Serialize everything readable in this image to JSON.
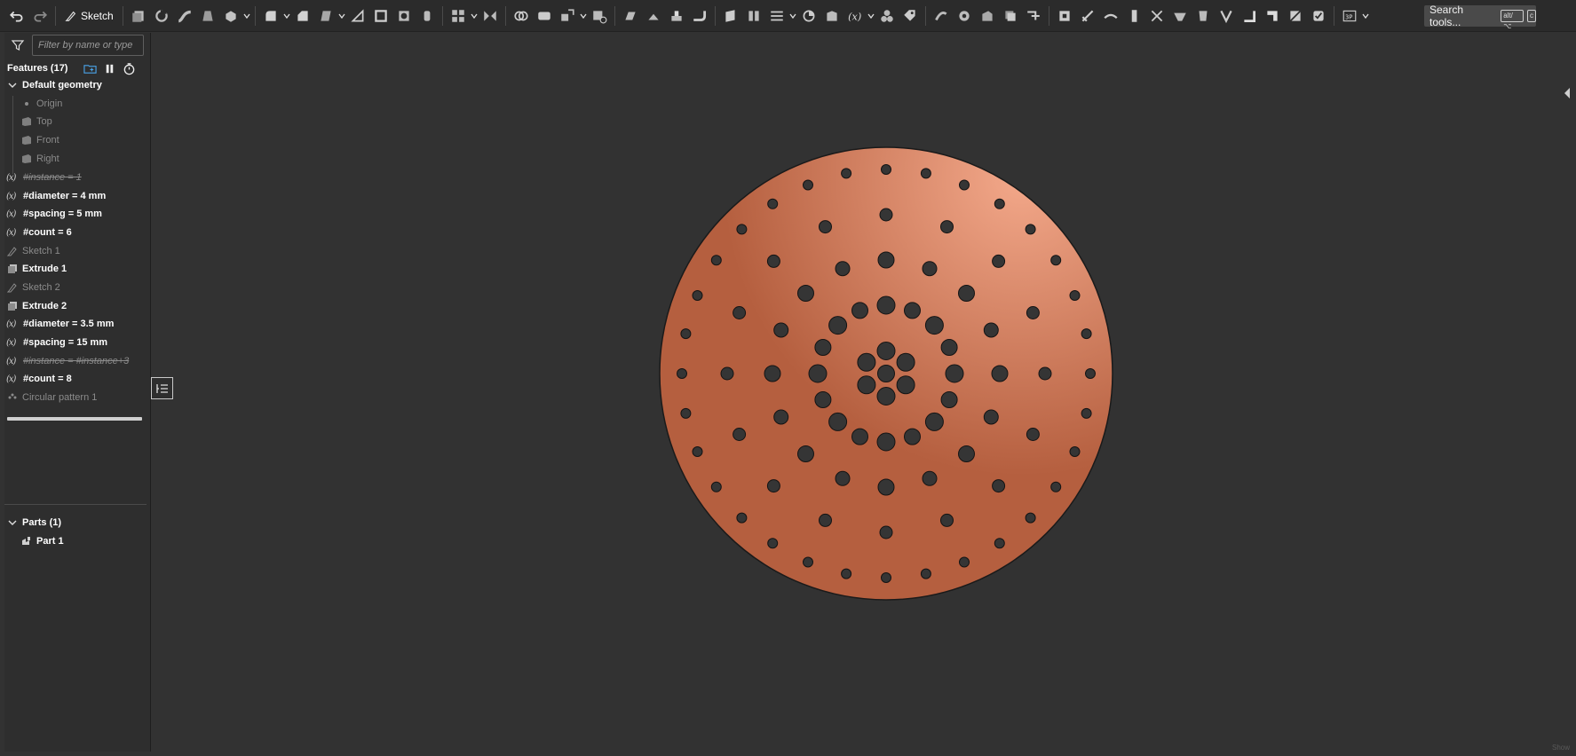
{
  "toolbar": {
    "sketch_label": "Sketch",
    "search_label": "Search tools...",
    "search_shortcut_1": "alt/⌥",
    "search_shortcut_2": "c",
    "icons": [
      "undo-icon",
      "redo-icon",
      "sketch-icon",
      "extrude-icon",
      "revolve-icon",
      "sweep-icon",
      "loft-icon",
      "thicken-icon",
      "fillet-icon",
      "chamfer-icon",
      "draft-icon",
      "rib-icon",
      "shell-icon",
      "hole-icon",
      "pattern-icon",
      "mirror-icon",
      "boolean-icon",
      "split-icon",
      "transform-icon",
      "delete-part-icon",
      "plane-icon",
      "mate-connector-icon",
      "variable-icon",
      "3d-view-icon"
    ]
  },
  "panel": {
    "filter_placeholder": "Filter by name or type",
    "features_title": "Features (17)",
    "default_geometry": "Default geometry",
    "origin": "Origin",
    "top": "Top",
    "front": "Front",
    "right": "Right",
    "features": [
      {
        "kind": "var",
        "label": "#instance = 1",
        "state": "suppressed"
      },
      {
        "kind": "var",
        "label": "#diameter = 4 mm",
        "state": "active"
      },
      {
        "kind": "var",
        "label": "#spacing = 5 mm",
        "state": "active"
      },
      {
        "kind": "var",
        "label": "#count = 6",
        "state": "active"
      },
      {
        "kind": "sketch",
        "label": "Sketch 1",
        "state": "hidden"
      },
      {
        "kind": "extrude",
        "label": "Extrude 1",
        "state": "active"
      },
      {
        "kind": "sketch",
        "label": "Sketch 2",
        "state": "hidden"
      },
      {
        "kind": "extrude",
        "label": "Extrude 2",
        "state": "active"
      },
      {
        "kind": "var",
        "label": "#diameter = 3.5 mm",
        "state": "active"
      },
      {
        "kind": "var",
        "label": "#spacing = 15 mm",
        "state": "active"
      },
      {
        "kind": "var",
        "label": "#instance = #instance+3",
        "state": "suppressed"
      },
      {
        "kind": "var",
        "label": "#count = 8",
        "state": "active"
      },
      {
        "kind": "pattern",
        "label": "Circular pattern 1",
        "state": "rolled-back"
      }
    ],
    "fx_symbol": "(x)",
    "parts_title": "Parts (1)",
    "part_name": "Part 1"
  },
  "viewport": {
    "plate_color": "#b55f3f",
    "plate_highlight": "#f3a88a",
    "hole_color": "#353535"
  },
  "corner_text": "Show"
}
